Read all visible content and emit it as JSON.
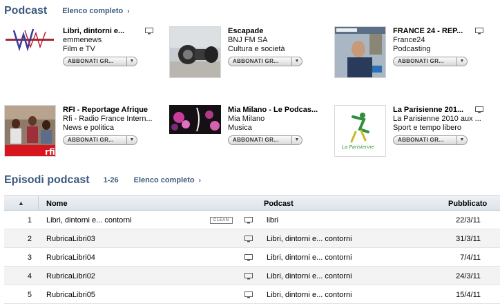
{
  "podcast_section": {
    "title": "Podcast",
    "full_list_label": "Elenco completo"
  },
  "podcasts": [
    {
      "title": "Libri, dintorni e...",
      "author": "emmenews",
      "category": "Film e TV",
      "subscribe_label": "ABBONATI GR..."
    },
    {
      "title": "Escapade",
      "author": "BNJ FM SA",
      "category": "Cultura e società",
      "subscribe_label": "ABBONATI GR..."
    },
    {
      "title": "FRANCE 24 - REP...",
      "author": "France24",
      "category": "Podcasting",
      "subscribe_label": "ABBONATI GR..."
    },
    {
      "title": "RFI - Reportage Afrique",
      "author": "Rfi - Radio France Intern...",
      "category": "News e politica",
      "subscribe_label": "ABBONATI GR..."
    },
    {
      "title": "Mia Milano - Le Podcas...",
      "author": "Mia Milano",
      "category": "Musica",
      "subscribe_label": "ABBONATI GR..."
    },
    {
      "title": "La Parisienne 201...",
      "author": "La Parisienne 2010 aux ...",
      "category": "Sport e tempo libero",
      "subscribe_label": "ABBONATI GR..."
    }
  ],
  "episodes_section": {
    "title": "Episodi podcast",
    "range": "1-26",
    "full_list_label": "Elenco completo"
  },
  "table": {
    "sort_indicator": "▲",
    "columns": {
      "name": "Nome",
      "podcast": "Podcast",
      "published": "Pubblicato"
    },
    "clean_badge": "CLEAN",
    "rows": [
      {
        "num": "1",
        "name": "Libri, dintorni e... contorni",
        "podcast": "libri",
        "date": "22/3/11"
      },
      {
        "num": "2",
        "name": "RubricaLibri03",
        "podcast": "Libri, dintorni e... contorni",
        "date": "31/3/11"
      },
      {
        "num": "3",
        "name": "RubricaLibri04",
        "podcast": "Libri, dintorni e... contorni",
        "date": "7/4/11"
      },
      {
        "num": "4",
        "name": "RubricaLibri02",
        "podcast": "Libri, dintorni e... contorni",
        "date": "24/3/11"
      },
      {
        "num": "5",
        "name": "RubricaLibri05",
        "podcast": "Libri, dintorni e... contorni",
        "date": "15/4/11"
      }
    ]
  },
  "colors": {
    "accent": "#3c5a7e",
    "rfi_red": "#d8141e",
    "alt_row": "#f3f3f3"
  },
  "icons": [
    "chevron-right-icon",
    "video-screen-icon",
    "sort-ascending-icon",
    "dropdown-arrow-icon"
  ]
}
